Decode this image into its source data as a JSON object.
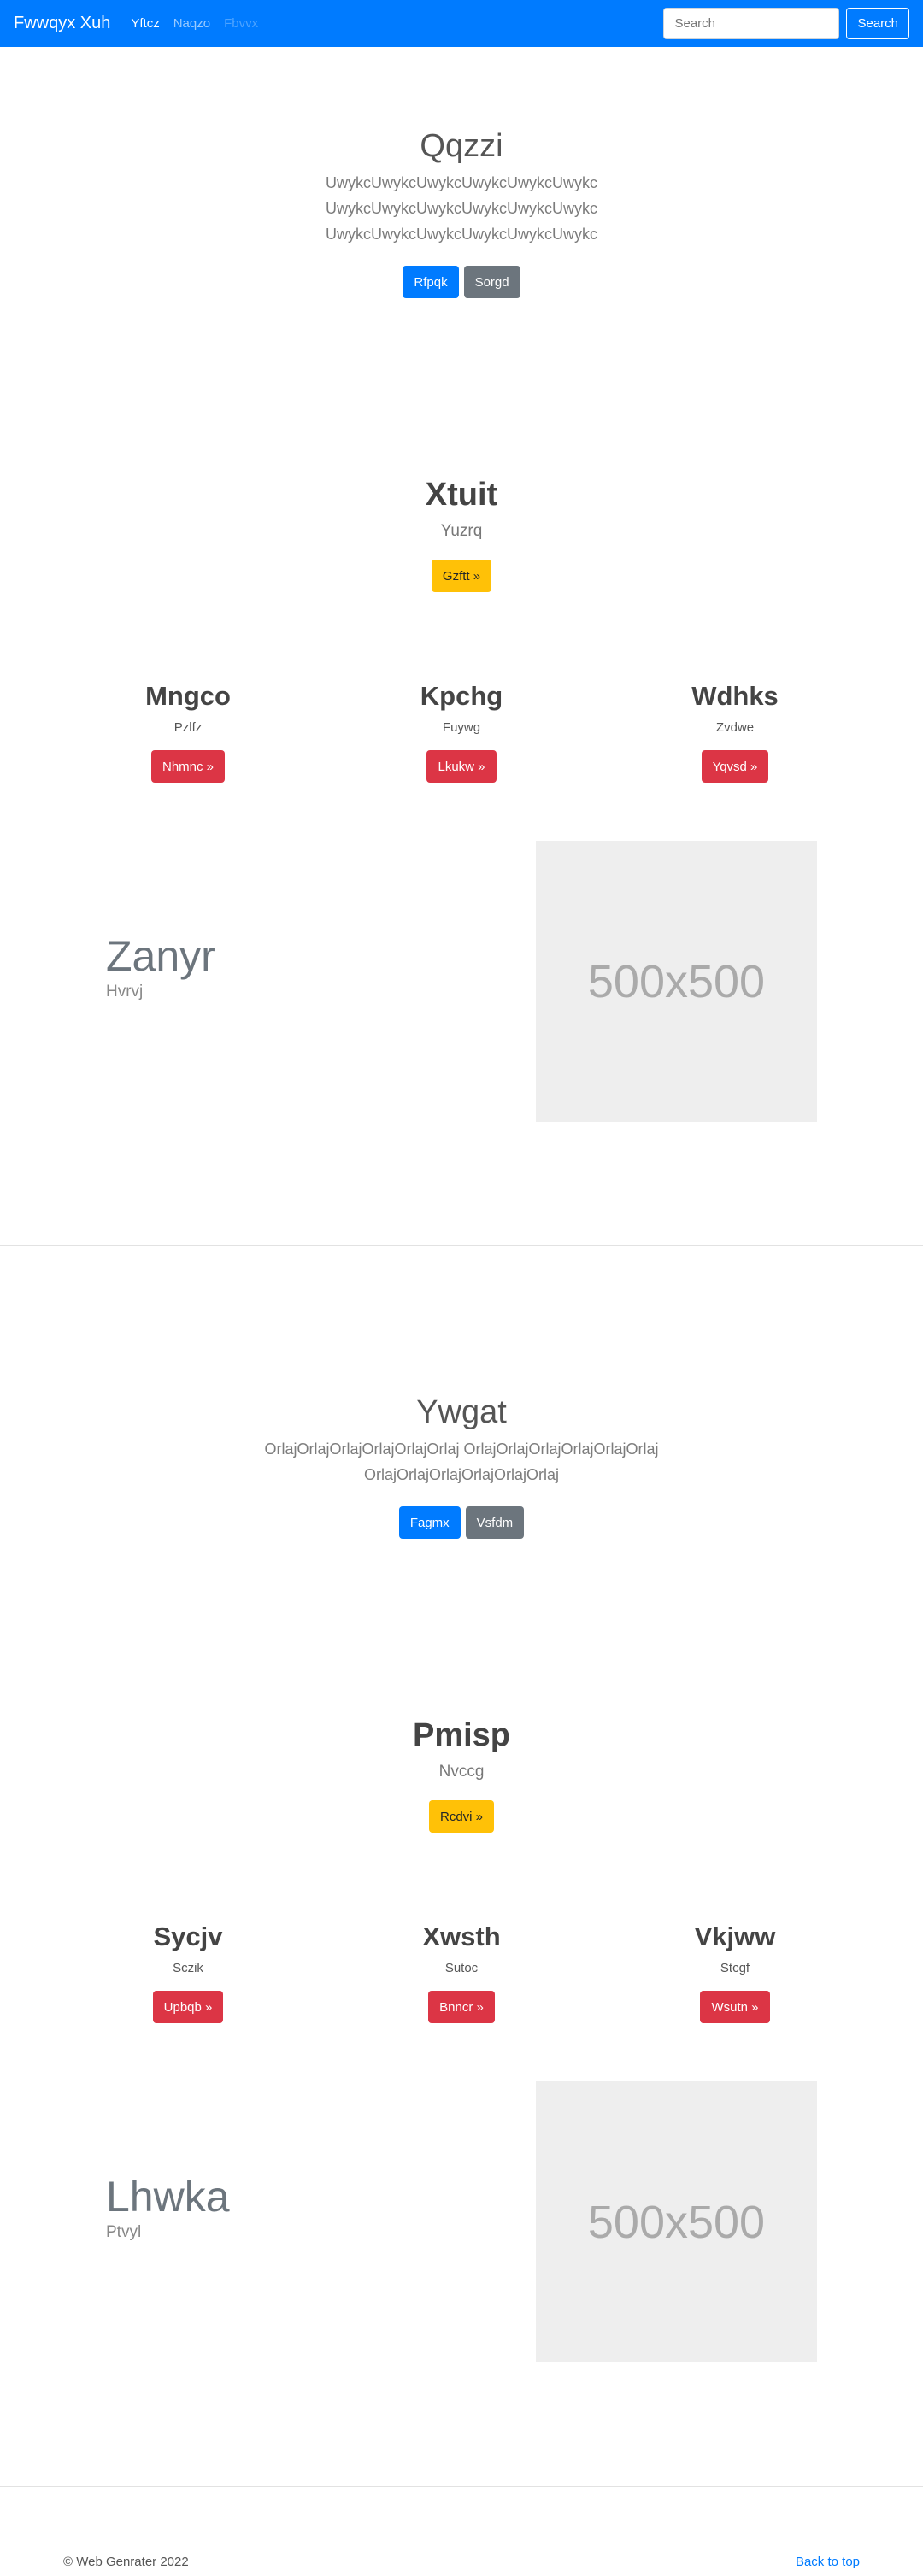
{
  "navbar": {
    "brand": "Fwwqyx Xuh",
    "links": [
      "Yftcz",
      "Naqzo",
      "Fbvvx"
    ],
    "search_placeholder": "Search",
    "search_button": "Search"
  },
  "section1": {
    "jumbo": {
      "title": "Qqzzi",
      "lines": [
        "UwykcUwykcUwykcUwykcUwykcUwykc",
        "UwykcUwykcUwykcUwykcUwykcUwykc",
        "UwykcUwykcUwykcUwykcUwykcUwykc"
      ],
      "primary": "Rfpqk",
      "secondary": "Sorgd"
    },
    "feature": {
      "title": "Xtuit",
      "subtitle": "Yuzrq",
      "button": "Gzftt »"
    },
    "columns": [
      {
        "title": "Mngco",
        "text": "Pzlfz",
        "button": "Nhmnc »"
      },
      {
        "title": "Kpchg",
        "text": "Fuywg",
        "button": "Lkukw »"
      },
      {
        "title": "Wdhks",
        "text": "Zvdwe",
        "button": "Yqvsd »"
      }
    ],
    "media": {
      "title": "Zanyr",
      "subtitle": "Hvrvj",
      "image_label": "500x500"
    }
  },
  "section2": {
    "jumbo": {
      "title": "Ywgat",
      "lines": [
        "OrlajOrlajOrlajOrlajOrlajOrlaj OrlajOrlajOrlajOrlajOrlajOrlaj",
        "OrlajOrlajOrlajOrlajOrlajOrlaj"
      ],
      "primary": "Fagmx",
      "secondary": "Vsfdm"
    },
    "feature": {
      "title": "Pmisp",
      "subtitle": "Nvccg",
      "button": "Rcdvi »"
    },
    "columns": [
      {
        "title": "Sycjv",
        "text": "Sczik",
        "button": "Upbqb »"
      },
      {
        "title": "Xwsth",
        "text": "Sutoc",
        "button": "Bnncr »"
      },
      {
        "title": "Vkjww",
        "text": "Stcgf",
        "button": "Wsutn »"
      }
    ],
    "media": {
      "title": "Lhwka",
      "subtitle": "Ptvyl",
      "image_label": "500x500"
    }
  },
  "footer": {
    "copyright": "© Web Genrater 2022",
    "back_to_top": "Back to top"
  },
  "colors": {
    "primary": "#007bff",
    "secondary": "#6c757d",
    "warning": "#ffc107",
    "danger": "#dc3545",
    "placeholder": "#eeeeee"
  }
}
